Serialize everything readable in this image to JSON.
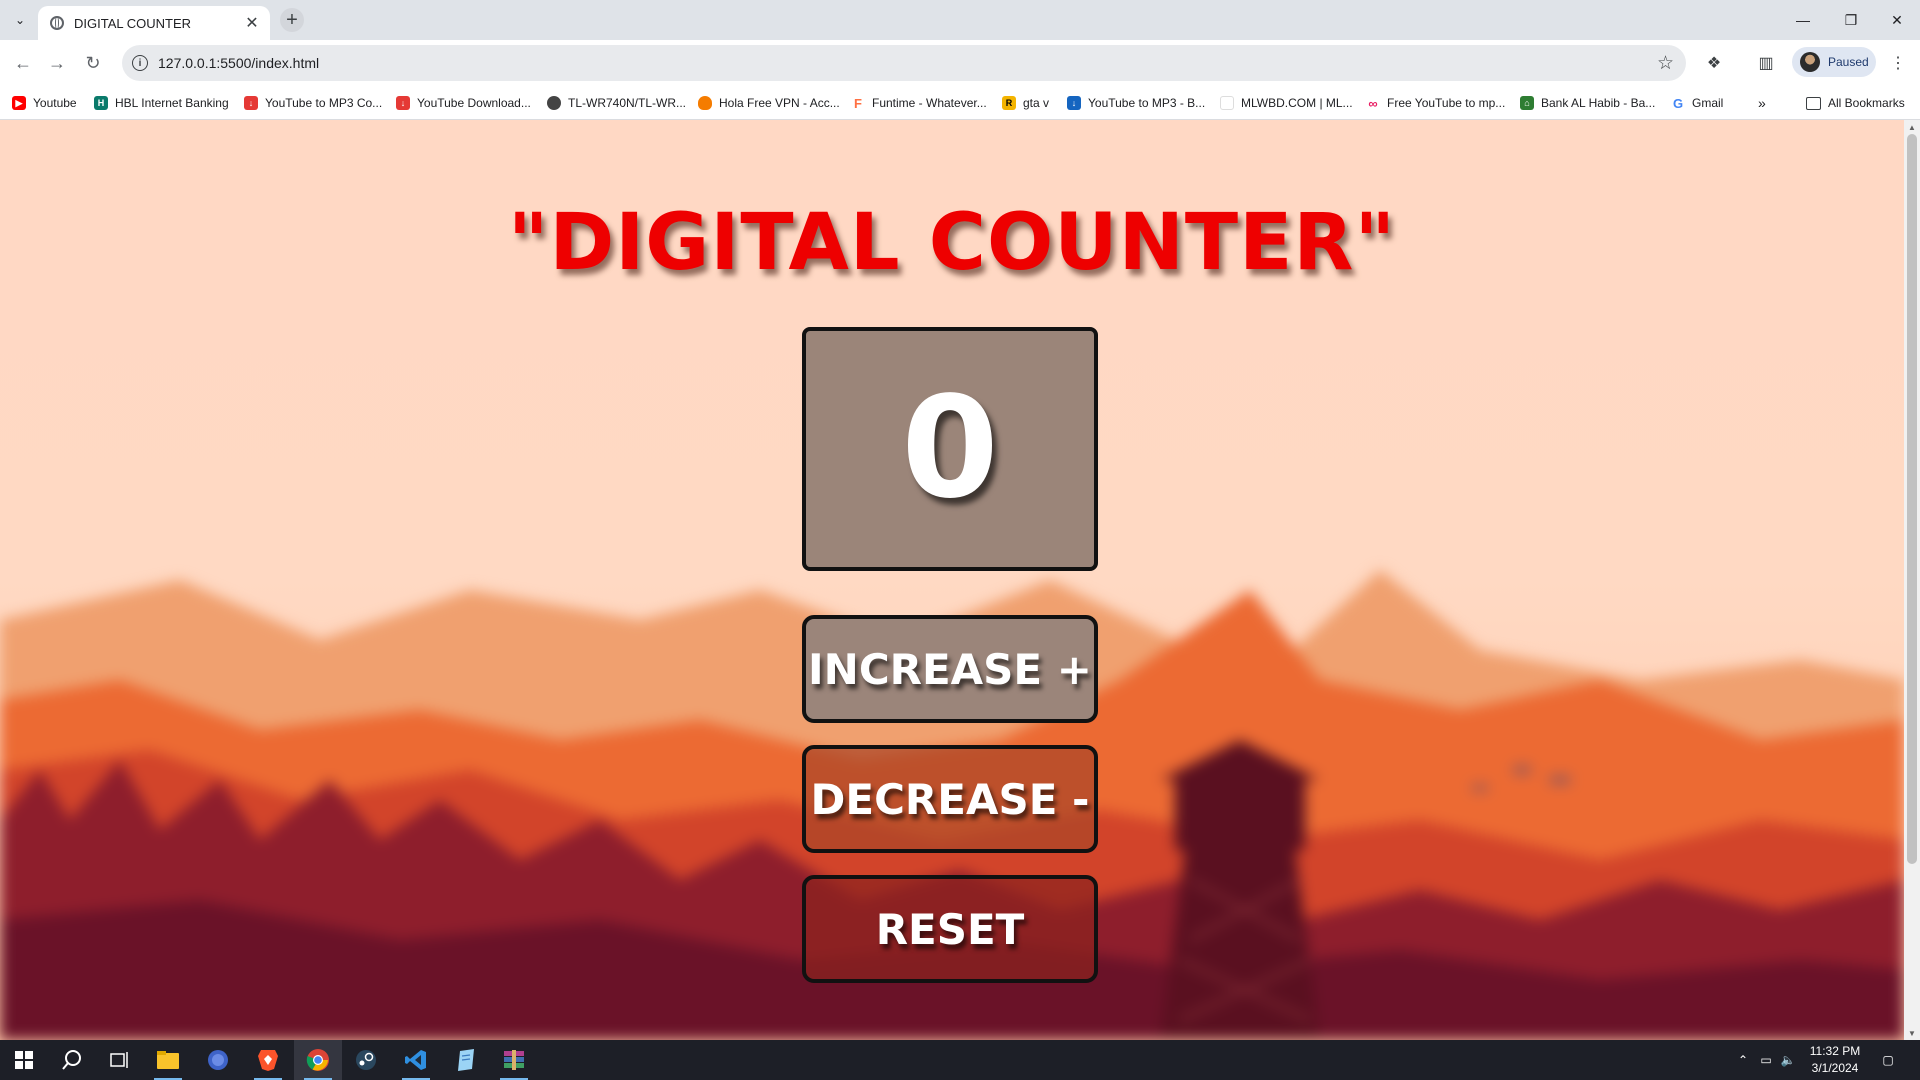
{
  "browser": {
    "tab_title": "DIGITAL COUNTER",
    "url": "127.0.0.1:5500/index.html",
    "profile_status": "Paused",
    "bookmarks": [
      {
        "label": "Youtube",
        "icon": "youtube-icon",
        "color": "#ff0000"
      },
      {
        "label": "HBL Internet Banking",
        "icon": "hbl-icon",
        "color": "#0a7a6b"
      },
      {
        "label": "YouTube to MP3 Co...",
        "icon": "download-icon",
        "color": "#e53935"
      },
      {
        "label": "YouTube Download...",
        "icon": "download-icon",
        "color": "#e53935"
      },
      {
        "label": "TL-WR740N/TL-WR...",
        "icon": "globe-icon",
        "color": "#444444"
      },
      {
        "label": "Hola Free VPN - Acc...",
        "icon": "flame-icon",
        "color": "#f57c00"
      },
      {
        "label": "Funtime - Whatever...",
        "icon": "funtime-icon",
        "color": "#ff7043"
      },
      {
        "label": "gta v",
        "icon": "rockstar-icon",
        "color": "#f4b400"
      },
      {
        "label": "YouTube to MP3 - B...",
        "icon": "download-icon",
        "color": "#1565c0"
      },
      {
        "label": "MLWBD.COM | ML...",
        "icon": "blank-page-icon",
        "color": "#ffffff"
      },
      {
        "label": "Free YouTube to mp...",
        "icon": "link-icon",
        "color": "#e91e63"
      },
      {
        "label": "Bank AL Habib - Ba...",
        "icon": "bank-icon",
        "color": "#2e7d32"
      },
      {
        "label": "Gmail",
        "icon": "google-icon",
        "color": "#4285f4"
      }
    ],
    "all_bookmarks": "All Bookmarks"
  },
  "page": {
    "title": "\"DIGITAL COUNTER\"",
    "counter_value": "0",
    "buttons": {
      "increase": "INCREASE +",
      "decrease": "DECREASE -",
      "reset": "RESET"
    },
    "colors": {
      "title": "#ee0000",
      "counter_bg": "#9b8579",
      "background": "#ffd8c4"
    }
  },
  "taskbar": {
    "time": "11:32 PM",
    "date": "3/1/2024",
    "apps": [
      "windows-start-icon",
      "search-icon",
      "task-view-icon",
      "file-explorer-icon",
      "firefox-icon",
      "brave-icon",
      "chrome-icon",
      "steam-icon",
      "vscode-icon",
      "notepad-icon",
      "winrar-icon"
    ]
  }
}
